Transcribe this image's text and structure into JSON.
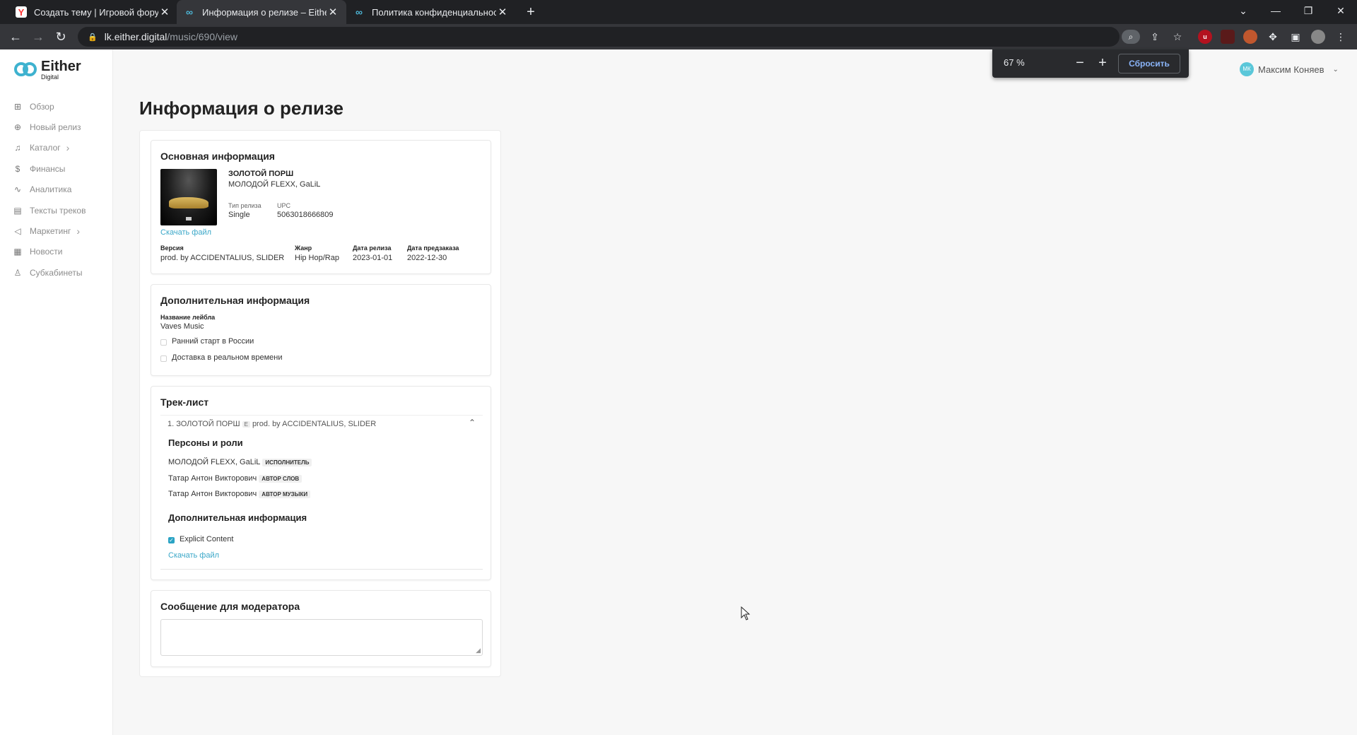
{
  "browser": {
    "tabs": [
      {
        "title": "Создать тему | Игровой форум",
        "favicon": "yandex-icon"
      },
      {
        "title": "Информация о релизе – Either Digital",
        "favicon": "either-icon",
        "active": true
      },
      {
        "title": "Политика конфиденциальности",
        "favicon": "either-icon"
      }
    ],
    "url_host": "lk.either.digital",
    "url_path": "/music/690/view",
    "zoom": {
      "value": "67 %",
      "reset_label": "Сбросить"
    }
  },
  "brand": {
    "name": "Either",
    "sub": "Digital",
    "color": "#3eb2cf"
  },
  "sidebar": {
    "items": [
      {
        "label": "Обзор",
        "icon": "dashboard-icon"
      },
      {
        "label": "Новый релиз",
        "icon": "plus-square-icon"
      },
      {
        "label": "Каталог",
        "icon": "music-note-icon",
        "chevron": true
      },
      {
        "label": "Финансы",
        "icon": "dollar-icon"
      },
      {
        "label": "Аналитика",
        "icon": "chart-line-icon"
      },
      {
        "label": "Тексты треков",
        "icon": "document-icon"
      },
      {
        "label": "Маркетинг",
        "icon": "megaphone-icon",
        "chevron": true
      },
      {
        "label": "Новости",
        "icon": "newspaper-icon"
      },
      {
        "label": "Субкабинеты",
        "icon": "user-icon"
      }
    ]
  },
  "user": {
    "initials": "МК",
    "name": "Максим Коняев"
  },
  "page": {
    "title": "Информация о релизе"
  },
  "main_info": {
    "heading": "Основная информация",
    "release_title": "ЗОЛОТОЙ ПОРШ",
    "artists": "МОЛОДОЙ FLEXX, GaLiL",
    "type_label": "Тип релиза",
    "type_value": "Single",
    "upc_label": "UPC",
    "upc_value": "5063018666809",
    "download": "Скачать файл",
    "version_label": "Версия",
    "version_value": "prod. by ACCIDENTALIUS, SLIDER",
    "genre_label": "Жанр",
    "genre_value": "Hip Hop/Rap",
    "release_date_label": "Дата релиза",
    "release_date_value": "2023-01-01",
    "preorder_label": "Дата предзаказа",
    "preorder_value": "2022-12-30"
  },
  "extra_info": {
    "heading": "Дополнительная информация",
    "label_label": "Название лейбла",
    "label_value": "Vaves Music",
    "early_start": "Ранний старт в России",
    "realtime_delivery": "Доставка в реальном времени"
  },
  "tracklist": {
    "heading": "Трек-лист",
    "track_title": "1. ЗОЛОТОЙ ПОРШ",
    "explicit_badge": "E",
    "track_version": "prod. by ACCIDENTALIUS, SLIDER",
    "persons_heading": "Персоны и роли",
    "persons": [
      {
        "name": "МОЛОДОЙ FLEXX, GaLiL",
        "role": "исполнитель"
      },
      {
        "name": "Татар Антон Викторович",
        "role": "автор слов"
      },
      {
        "name": "Татар Антон Викторович",
        "role": "автор музыки"
      }
    ],
    "extra_heading": "Дополнительная информация",
    "explicit_label": "Explicit Content",
    "download": "Скачать файл"
  },
  "moderator": {
    "heading": "Сообщение для модератора"
  }
}
